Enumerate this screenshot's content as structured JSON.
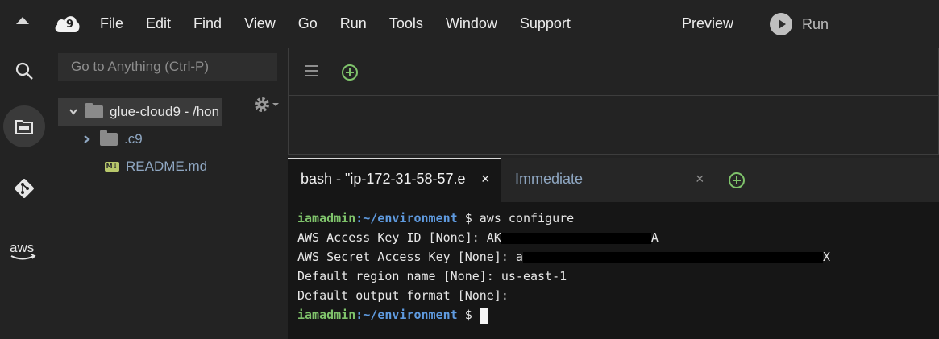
{
  "menu": {
    "items": [
      "File",
      "Edit",
      "Find",
      "View",
      "Go",
      "Run",
      "Tools",
      "Window",
      "Support"
    ],
    "preview": "Preview",
    "run": "Run"
  },
  "rail": {
    "icons": [
      "search-icon",
      "files-icon",
      "git-icon",
      "aws-icon"
    ],
    "aws_label": "aws"
  },
  "tree": {
    "goto_placeholder": "Go to Anything (Ctrl-P)",
    "root": "glue-cloud9 - /hon",
    "folder": ".c9",
    "file": "README.md",
    "file_badge": "M↓"
  },
  "terminal": {
    "tab1_label": "bash - \"ip-172-31-58-57.e",
    "tab1_close": "×",
    "tab2_label": "Immediate",
    "tab2_close": "×",
    "user": "iamadmin",
    "path": ":~/environment",
    "dollar": " $ ",
    "cmd": "aws configure",
    "line1": "AWS Access Key ID [None]: AK",
    "line1_tail": "A",
    "line2": "AWS Secret Access Key [None]: a",
    "line2_tail": "X",
    "line3": "Default region name [None]: us-east-1",
    "line4": "Default output format [None]:"
  },
  "colors": {
    "accent_green": "#7fc36b",
    "path_blue": "#5f9be0",
    "link_blue": "#8fa7c2"
  }
}
